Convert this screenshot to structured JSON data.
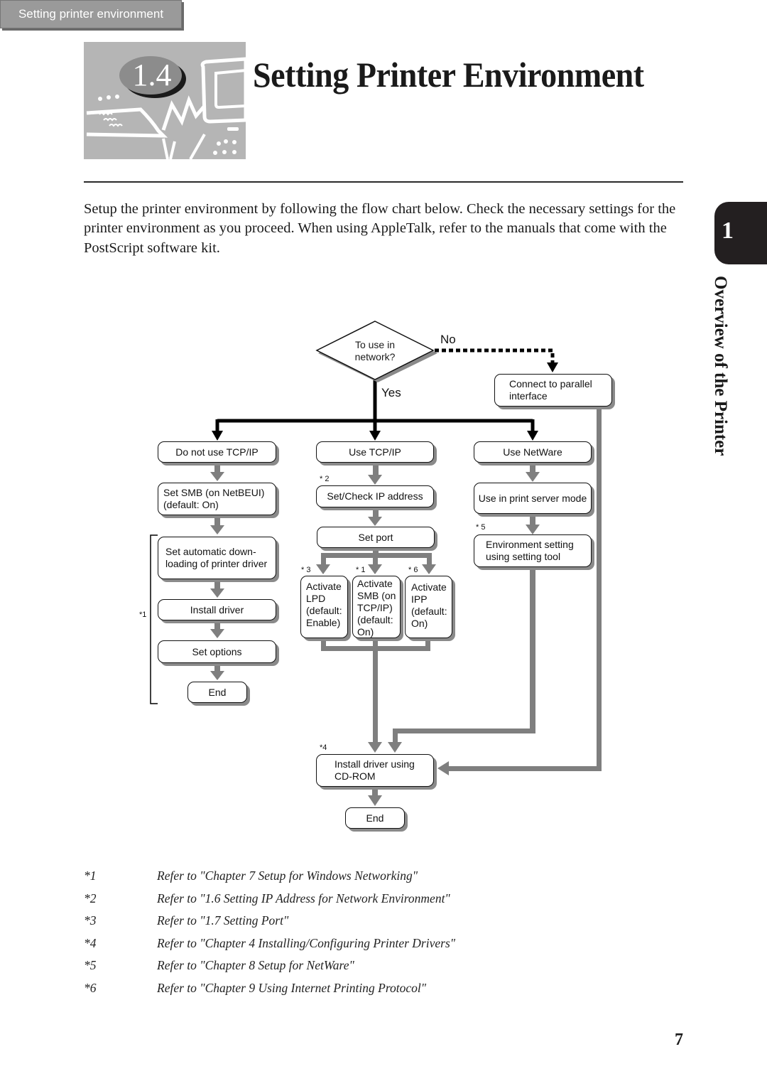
{
  "header": {
    "section_number": "1.4",
    "title": "Setting Printer Environment"
  },
  "intro": "Setup the printer environment by following the flow chart below. Check the necessary settings for the printer environment as you proceed. When using AppleTalk, refer to the manuals that come with the PostScript software kit.",
  "chapter_tab": {
    "number": "1",
    "title": "Overview of the Printer"
  },
  "flowchart": {
    "start": "Setting printer environment",
    "decision": "To use in\nnetwork?",
    "yes_label": "Yes",
    "no_label": "No",
    "parallel": "Connect to parallel\ninterface",
    "left": {
      "head": "Do not use TCP/IP",
      "smb": "Set SMB (on NetBEUI)\n(default: On)",
      "auto_download": "Set automatic down-\nloading of printer driver",
      "install_driver": "Install driver",
      "set_options": "Set options",
      "end": "End",
      "bracket_note": "*1"
    },
    "middle": {
      "head": "Use TCP/IP",
      "ip_note": "* 2",
      "ip": "Set/Check IP address",
      "port": "Set port",
      "lpd_note": "* 3",
      "lpd": "Activate\nLPD\n(default:\nEnable)",
      "smb_note": "* 1",
      "smb": "Activate\nSMB (on\n TCP/IP)\n(default:\n On)",
      "ipp_note": "* 6",
      "ipp": "Activate\nIPP\n(default:\n On)"
    },
    "right": {
      "head": "Use NetWare",
      "print_server": "Use in print server mode",
      "env_note": "* 5",
      "env": "Environment setting\nusing setting tool"
    },
    "cdrom_note": "*4",
    "cdrom": "Install driver using\nCD-ROM",
    "end": "End"
  },
  "footnotes": [
    {
      "key": "*1",
      "text": "Refer to \"Chapter 7 Setup for Windows Networking\""
    },
    {
      "key": "*2",
      "text": "Refer to \"1.6 Setting IP Address for Network Environment\""
    },
    {
      "key": "*3",
      "text": "Refer to \"1.7 Setting Port\""
    },
    {
      "key": "*4",
      "text": "Refer to \"Chapter 4 Installing/Configuring Printer Drivers\""
    },
    {
      "key": "*5",
      "text": "Refer to \"Chapter 8 Setup for NetWare\""
    },
    {
      "key": "*6",
      "text": "Refer to \"Chapter 9 Using Internet Printing Protocol\""
    }
  ],
  "page_number": "7"
}
